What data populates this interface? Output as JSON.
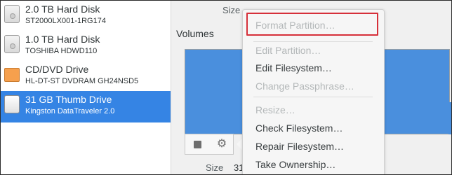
{
  "drives": [
    {
      "name": "2.0 TB Hard Disk",
      "model": "ST2000LX001-1RG174",
      "icon": "hard-disk-icon",
      "selected": false
    },
    {
      "name": "1.0 TB Hard Disk",
      "model": "TOSHIBA HDWD110",
      "icon": "hard-disk-icon",
      "selected": false
    },
    {
      "name": "CD/DVD Drive",
      "model": "HL-DT-ST DVDRAM GH24NSD5",
      "icon": "optical-drive-icon",
      "selected": false
    },
    {
      "name": "31 GB Thumb Drive",
      "model": "Kingston DataTraveler 2.0",
      "icon": "usb-drive-icon",
      "selected": true
    }
  ],
  "details": {
    "size_label": "Size",
    "volumes_title": "Volumes",
    "bottom_size_label": "Size",
    "bottom_size_value": "31"
  },
  "menu": {
    "items": [
      {
        "label": "Format Partition…",
        "enabled": false
      },
      {
        "label": "Edit Partition…",
        "enabled": false
      },
      {
        "label": "Edit Filesystem…",
        "enabled": true
      },
      {
        "label": "Change Passphrase…",
        "enabled": false
      },
      {
        "label": "Resize…",
        "enabled": false
      },
      {
        "label": "Check Filesystem…",
        "enabled": true
      },
      {
        "label": "Repair Filesystem…",
        "enabled": true
      },
      {
        "label": "Take Ownership…",
        "enabled": true
      }
    ]
  },
  "colors": {
    "selection": "#3584e4",
    "volume_fill": "#4a8fdd",
    "highlight_border": "#d6303a"
  }
}
